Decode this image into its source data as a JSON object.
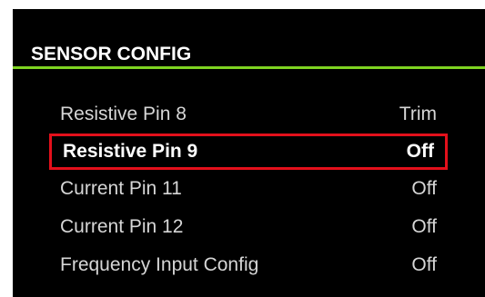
{
  "header": {
    "title": "SENSOR CONFIG"
  },
  "colors": {
    "accent": "#7ed321",
    "selection_border": "#e3101b",
    "background": "#000000",
    "text": "#d6d6d6",
    "text_selected": "#ffffff"
  },
  "menu": {
    "items": [
      {
        "label": "Resistive Pin 8",
        "value": "Trim",
        "selected": false
      },
      {
        "label": "Resistive Pin 9",
        "value": "Off",
        "selected": true
      },
      {
        "label": "Current Pin 11",
        "value": "Off",
        "selected": false
      },
      {
        "label": "Current Pin 12",
        "value": "Off",
        "selected": false
      },
      {
        "label": "Frequency Input Config",
        "value": "Off",
        "selected": false
      }
    ]
  }
}
